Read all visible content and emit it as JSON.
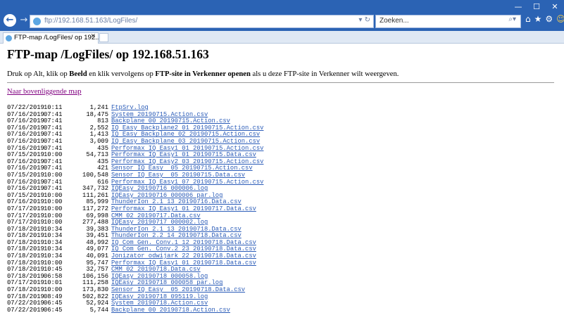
{
  "browser": {
    "url": "ftp://192.168.51.163/LogFiles/",
    "address_buttons": "▾ ↻",
    "search_placeholder": "Zoeken...",
    "tab_title": "FTP-map /LogFiles/ op 192...."
  },
  "page": {
    "title": "FTP-map /LogFiles/ op 192.168.51.163",
    "instruction": {
      "t1": "Druk op Alt, klik op ",
      "b1": "Beeld",
      "t2": " en klik vervolgens op ",
      "b2": "FTP-site in Verkenner openen",
      "t3": " als u deze FTP-site in Verkenner wilt weergeven."
    },
    "parent_link": "Naar bovenliggende map"
  },
  "files": [
    {
      "date": "07/22/2019",
      "time": "10:11",
      "size": "1,241",
      "name": "FtpSrv.log"
    },
    {
      "date": "07/16/2019",
      "time": "07:41",
      "size": "18,475",
      "name": "System 20190715.Action.csv"
    },
    {
      "date": "07/16/2019",
      "time": "07:41",
      "size": "813",
      "name": "Backplane 00 20190715.Action.csv"
    },
    {
      "date": "07/16/2019",
      "time": "07:41",
      "size": "2,552",
      "name": "IQ Easy Backplane2 01 20190715.Action.csv"
    },
    {
      "date": "07/16/2019",
      "time": "07:41",
      "size": "1,413",
      "name": "IQ Easy Backplane 02 20190715.Action.csv"
    },
    {
      "date": "07/16/2019",
      "time": "07:41",
      "size": "3,009",
      "name": "IQ Easy Backplane 03 20190715.Action.csv"
    },
    {
      "date": "07/16/2019",
      "time": "07:41",
      "size": "435",
      "name": "Performax IQ Easy1 01 20190715.Action.csv"
    },
    {
      "date": "07/15/2019",
      "time": "10:00",
      "size": "54,713",
      "name": "Performax IQ Easy1 01 20190715.Data.csv"
    },
    {
      "date": "07/16/2019",
      "time": "07:41",
      "size": "435",
      "name": "Performax IQ Easy2 03 20190715.Action.csv"
    },
    {
      "date": "07/16/2019",
      "time": "07:41",
      "size": "421",
      "name": "Sensor IQ Easy  05 20190715.Action.csv"
    },
    {
      "date": "07/15/2019",
      "time": "10:00",
      "size": "100,548",
      "name": "Sensor IQ Easy  05 20190715.Data.csv"
    },
    {
      "date": "07/16/2019",
      "time": "07:41",
      "size": "616",
      "name": "Performax IQ Easy1 07 20190715.Action.csv"
    },
    {
      "date": "07/16/2019",
      "time": "07:41",
      "size": "347,732",
      "name": "IQEasy 20190716 000006.log"
    },
    {
      "date": "07/15/2019",
      "time": "10:00",
      "size": "111,261",
      "name": "IQEasy 20190716 000006 par.log"
    },
    {
      "date": "07/16/2019",
      "time": "10:00",
      "size": "85,999",
      "name": "ThunderIon 2.1 13 20190716.Data.csv"
    },
    {
      "date": "07/17/2019",
      "time": "10:00",
      "size": "117,272",
      "name": "Performax IQ Easy1 01 20190717.Data.csv"
    },
    {
      "date": "07/17/2019",
      "time": "10:00",
      "size": "69,998",
      "name": "CMM 02 20190717.Data.csv"
    },
    {
      "date": "07/17/2019",
      "time": "10:00",
      "size": "277,488",
      "name": "IQEasy 20190717 000002.log"
    },
    {
      "date": "07/18/2019",
      "time": "10:34",
      "size": "39,383",
      "name": "ThunderIon 2.1 13 20190718.Data.csv"
    },
    {
      "date": "07/18/2019",
      "time": "10:34",
      "size": "39,451",
      "name": "ThunderIon 2.2 14 20190718.Data.csv"
    },
    {
      "date": "07/18/2019",
      "time": "10:34",
      "size": "48,992",
      "name": "IQ Com Gen. Conv.1 12 20190718.Data.csv"
    },
    {
      "date": "07/18/2019",
      "time": "10:34",
      "size": "49,077",
      "name": "IQ Com Gen. Conv.2 23 20190718.Data.csv"
    },
    {
      "date": "07/18/2019",
      "time": "10:34",
      "size": "40,091",
      "name": "Jonizator odwijark 22 20190718.Data.csv"
    },
    {
      "date": "07/18/2019",
      "time": "10:00",
      "size": "95,747",
      "name": "Performax IQ Easy1 01 20190718.Data.csv"
    },
    {
      "date": "07/18/2019",
      "time": "10:45",
      "size": "32,757",
      "name": "CMM 02 20190718.Data.csv"
    },
    {
      "date": "07/18/2019",
      "time": "06:58",
      "size": "106,156",
      "name": "IQEasy 20190718 000058.log"
    },
    {
      "date": "07/17/2019",
      "time": "10:01",
      "size": "111,258",
      "name": "IQEasy 20190718 000058 par.log"
    },
    {
      "date": "07/18/2019",
      "time": "10:00",
      "size": "173,830",
      "name": "Sensor IQ Easy  05 20190718.Data.csv"
    },
    {
      "date": "07/18/2019",
      "time": "08:49",
      "size": "502,822",
      "name": "IQEasy 20190718 095119.log"
    },
    {
      "date": "07/22/2019",
      "time": "06:45",
      "size": "52,924",
      "name": "System 20190718.Action.csv"
    },
    {
      "date": "07/22/2019",
      "time": "06:45",
      "size": "5,744",
      "name": "Backplane 00 20190718.Action.csv"
    }
  ],
  "colors": {
    "titlebar": "#2b63b4",
    "link": "#2b5cb8",
    "visited_link": "#800080"
  }
}
